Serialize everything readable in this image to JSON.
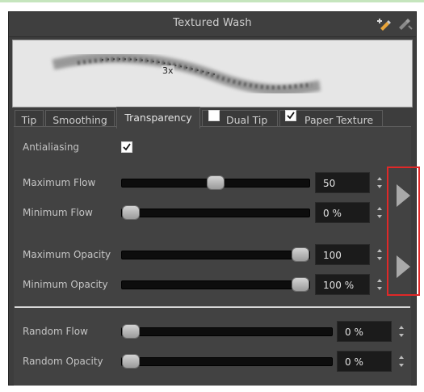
{
  "panel": {
    "title": "Textured Wash",
    "icons": [
      "new-brush-icon",
      "settings-icon"
    ],
    "preview": {
      "zoom_label": "3x"
    }
  },
  "tabs": [
    {
      "label": "Tip"
    },
    {
      "label": "Smoothing"
    },
    {
      "label": "Transparency",
      "active": true
    },
    {
      "label": "Dual Tip",
      "checked": false
    },
    {
      "label": "Paper Texture",
      "checked": true
    }
  ],
  "transparency": {
    "antialiasing": {
      "label": "Antialiasing",
      "checked": true
    },
    "max_flow": {
      "label": "Maximum Flow",
      "value": "50",
      "fraction": 0.5
    },
    "min_flow": {
      "label": "Minimum Flow",
      "value": "0 %",
      "fraction": 0.0
    },
    "max_opacity": {
      "label": "Maximum Opacity",
      "value": "100",
      "fraction": 1.0
    },
    "min_opacity": {
      "label": "Minimum Opacity",
      "value": "100 %",
      "fraction": 1.0
    },
    "random_flow": {
      "label": "Random Flow",
      "value": "0 %",
      "fraction": 0.0
    },
    "random_opacity": {
      "label": "Random Opacity",
      "value": "0 %",
      "fraction": 0.0
    }
  },
  "colors": {
    "panel_bg": "#424242",
    "highlight_border": "#e02828",
    "field_bg": "#1b1b1b"
  }
}
